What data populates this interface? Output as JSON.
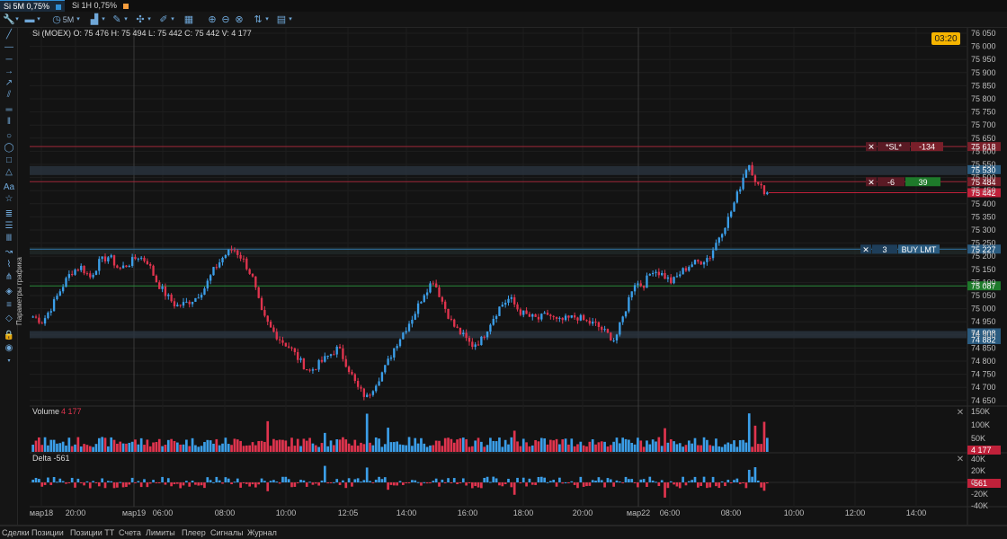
{
  "tabs": [
    {
      "label": "Si 5M",
      "pct": "0,75%",
      "color": "#2f8fd6",
      "active": true
    },
    {
      "label": "Si 1H",
      "pct": "0,75%",
      "color": "#f59d3d",
      "active": false
    }
  ],
  "toolbar": {
    "timeframe": "5M",
    "icons": [
      "wrench-icon",
      "chevron-down-icon",
      "folder-icon",
      "chevron-down-icon",
      "clock-icon",
      "timeframe-dropdown",
      "chevron-down-icon",
      "chart-type-icon",
      "chevron-down-icon",
      "pen-icon",
      "chevron-down-icon",
      "cursor-icon",
      "chevron-down-icon",
      "indicator-icon",
      "zoom-in-icon",
      "zoom-out-icon",
      "zoom-fit-icon",
      "sort-icon",
      "chevron-down-icon",
      "calendar-icon",
      "chevron-down-icon"
    ]
  },
  "left_tools": [
    "pen-icon",
    "line-icon",
    "hline-icon",
    "ray-icon",
    "arrow-icon",
    "channel-icon",
    "hlines-icon",
    "vlines-icon",
    "circle-icon",
    "ellipse-icon",
    "rect-icon",
    "triangle-icon",
    "text-icon",
    "star-icon",
    "fib-icon",
    "fib2-icon",
    "grid-icon",
    "trend-icon",
    "wave-icon",
    "pitchfork-icon",
    "layers-icon",
    "list-icon",
    "eraser-icon",
    "lock-icon",
    "eye-icon",
    "small-icon"
  ],
  "vertical_label": "Параметры графика",
  "price_pane": {
    "info": "Si (MOEX) O: 75 476  H: 75 494  L: 75 442  C: 75 442  V: 4 177",
    "timer": "03:20",
    "y_ticks": [
      "76 050",
      "76 000",
      "75 950",
      "75 900",
      "75 850",
      "75 800",
      "75 750",
      "75 700",
      "75 650",
      "75 600",
      "75 550",
      "75 500",
      "75 450",
      "75 400",
      "75 350",
      "75 300",
      "75 250",
      "75 200",
      "75 150",
      "75 100",
      "75 050",
      "75 000",
      "74 950",
      "74 900",
      "74 850",
      "74 800",
      "74 750",
      "74 700",
      "74 650"
    ],
    "price_tags": [
      {
        "label": "75 618",
        "bg": "#7a1f2a"
      },
      {
        "label": "75 530",
        "bg": "#2a5b80"
      },
      {
        "label": "75 484",
        "bg": "#7a1f2a"
      },
      {
        "label": "75 442",
        "bg": "#c0213a"
      },
      {
        "label": "75 227",
        "bg": "#2a5b80"
      },
      {
        "label": "75 087",
        "bg": "#1e7a2a"
      },
      {
        "label": "74 908",
        "bg": "#2a5b80"
      },
      {
        "label": "74 882",
        "bg": "#2a5b80"
      }
    ],
    "orders": [
      {
        "close": "✕",
        "name": "*SL*",
        "value": "-134"
      },
      {
        "close": "✕",
        "name": "-6",
        "value": "39"
      },
      {
        "close": "✕",
        "name": "3",
        "value": "BUY LMT"
      }
    ]
  },
  "volume_pane": {
    "label": "Volume",
    "value": "4 177",
    "ticks": [
      "150K",
      "100K",
      "50K"
    ],
    "tag": "4 177"
  },
  "delta_pane": {
    "label": "Delta",
    "value": "-561",
    "ticks": [
      "40K",
      "20K",
      "0",
      "-20K",
      "-40K"
    ],
    "tag": "-561"
  },
  "x_axis": [
    "мар18",
    "20:00",
    "мар19",
    "06:00",
    "08:00",
    "10:00",
    "12:05",
    "14:00",
    "16:00",
    "18:00",
    "20:00",
    "мар22",
    "06:00",
    "08:00",
    "10:00",
    "12:00",
    "14:00"
  ],
  "bottom_tabs": [
    "Сделки",
    "Позиции",
    "Позиции ТТ",
    "Счета",
    "Лимиты",
    "Плеер",
    "Сигналы",
    "Журнал"
  ],
  "chart_data": {
    "type": "candlestick",
    "symbol": "Si (MOEX)",
    "timeframe": "5M",
    "ylim": [
      74620,
      76060
    ],
    "close_series_approx": [
      74970,
      74950,
      75010,
      75080,
      75140,
      75160,
      75120,
      75180,
      75200,
      75150,
      75170,
      75200,
      75180,
      75100,
      75050,
      75010,
      75020,
      75040,
      75080,
      75150,
      75200,
      75230,
      75190,
      75120,
      74980,
      74920,
      74880,
      74850,
      74800,
      74760,
      74790,
      74820,
      74850,
      74780,
      74700,
      74660,
      74720,
      74780,
      74860,
      74920,
      74980,
      75060,
      75110,
      75020,
      74940,
      74900,
      74860,
      74880,
      74950,
      75010,
      75040,
      74990,
      74970,
      74960,
      74980,
      74950,
      74960,
      74970,
      74950,
      74940,
      74910,
      74880,
      74980,
      75100,
      75090,
      75150,
      75130,
      75100,
      75140,
      75170,
      75180,
      75200,
      75280,
      75350,
      75450,
      75560,
      75470,
      75442
    ]
  }
}
